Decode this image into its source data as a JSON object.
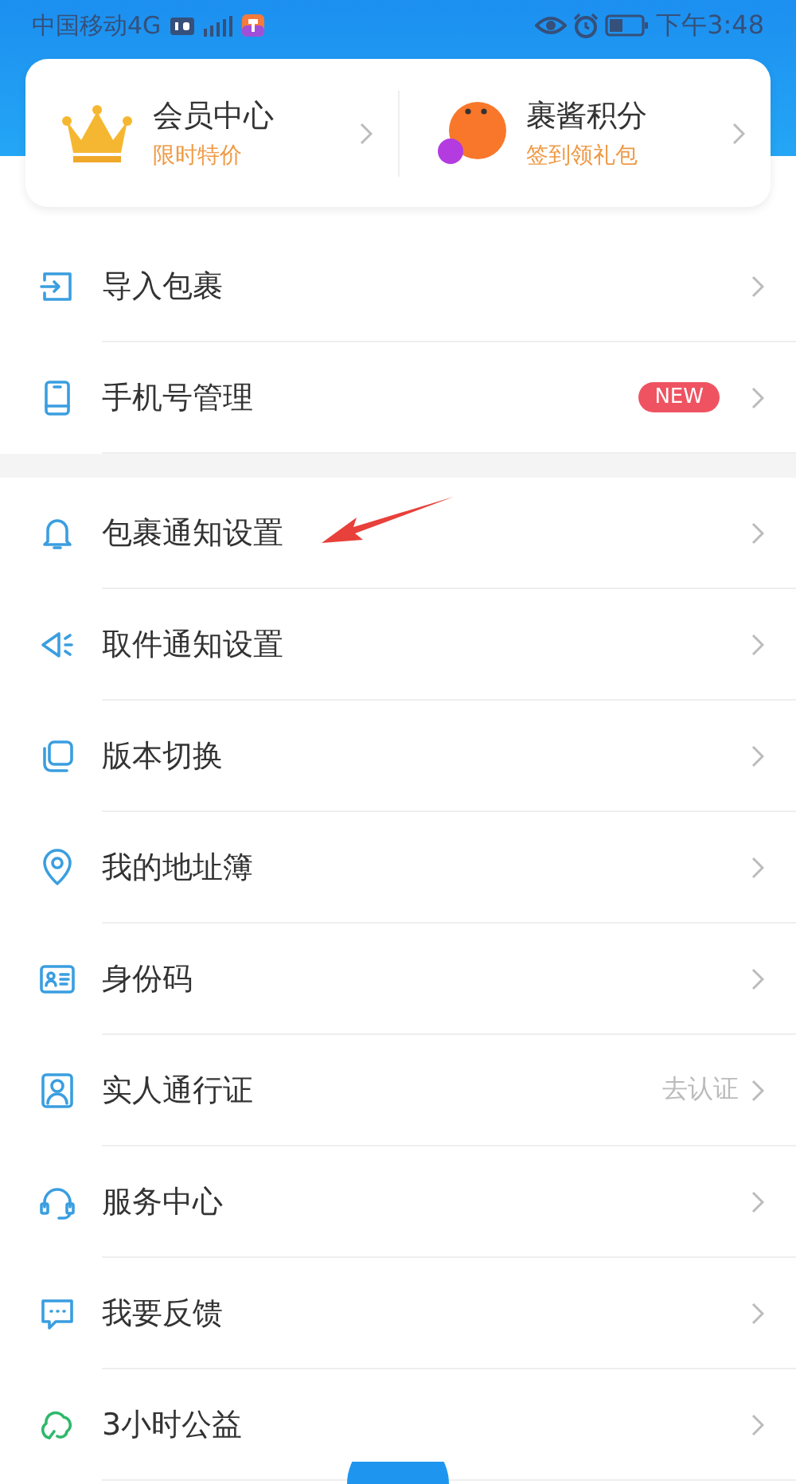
{
  "status_bar": {
    "carrier": "中国移动4G",
    "time": "下午3:48"
  },
  "cards": [
    {
      "title": "会员中心",
      "subtitle": "限时特价"
    },
    {
      "title": "裹酱积分",
      "subtitle": "签到领礼包"
    }
  ],
  "sections": [
    {
      "items": [
        {
          "label": "导入包裹"
        },
        {
          "label": "手机号管理",
          "badge": "NEW"
        }
      ]
    },
    {
      "items": [
        {
          "label": "包裹通知设置",
          "annotated": true
        },
        {
          "label": "取件通知设置"
        },
        {
          "label": "版本切换"
        },
        {
          "label": "我的地址簿"
        },
        {
          "label": "身份码"
        },
        {
          "label": "实人通行证",
          "hint": "去认证"
        },
        {
          "label": "服务中心"
        },
        {
          "label": "我要反馈"
        },
        {
          "label": "3小时公益"
        }
      ]
    }
  ]
}
